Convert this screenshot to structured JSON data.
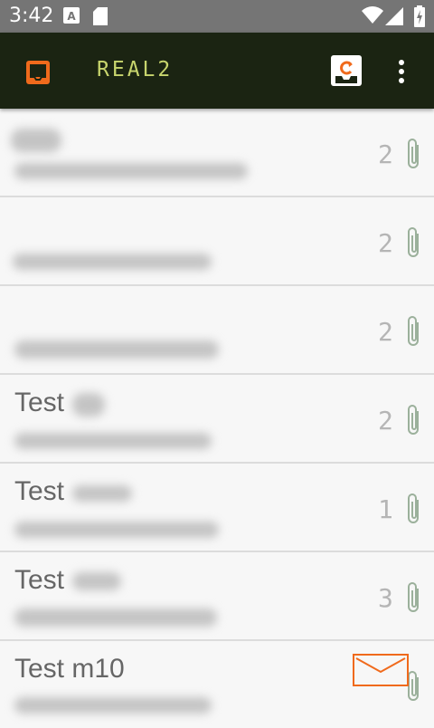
{
  "status_bar": {
    "time": "3:42",
    "icons": [
      "font-icon",
      "sd-card-icon",
      "wifi-icon",
      "signal-icon",
      "battery-charging-icon"
    ]
  },
  "app_bar": {
    "title": "REAL2",
    "accent_color": "#f06a1c",
    "background": "#1b2412"
  },
  "messages": [
    {
      "sender": "",
      "count": "2",
      "has_attachment": true
    },
    {
      "sender": "",
      "count": "2",
      "has_attachment": true
    },
    {
      "sender": "",
      "count": "2",
      "has_attachment": true
    },
    {
      "sender": "Test",
      "count": "2",
      "has_attachment": true
    },
    {
      "sender": "Test",
      "count": "1",
      "has_attachment": true
    },
    {
      "sender": "Test",
      "count": "3",
      "has_attachment": true
    },
    {
      "sender": "Test m10",
      "count": "",
      "has_attachment": true
    }
  ]
}
